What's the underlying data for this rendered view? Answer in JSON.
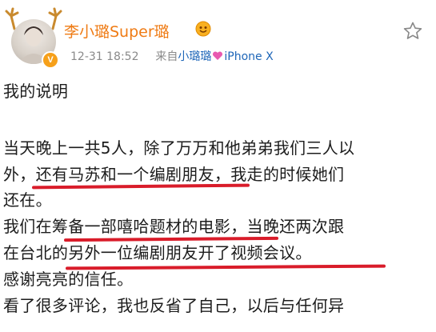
{
  "post": {
    "username": "李小璐Super璐",
    "timestamp": "12-31 18:52",
    "source_prefix": "来自",
    "source_name": "小璐璐",
    "source_device": "iPhone X",
    "lines": [
      "我的说明",
      "当天晚上一共5人，除了万万和他弟弟我们三人以",
      "外，",
      "还有马苏和一个编剧朋友",
      "，我走的时候她们",
      "还在。",
      "我们在",
      "筹备一部嘻哈题材的电影",
      "，当晚还两次跟",
      "在台北的",
      "另外一位编剧朋友开了视频会议。",
      "感谢亮亮的信任。",
      "看了很多评论，我也反省了自己，以后与任何异"
    ]
  },
  "icons": {
    "verified": "vip-badge-icon",
    "favorite": "star-outline-icon",
    "gold": "gold-member-icon",
    "source_heart": "heart-icon"
  },
  "colors": {
    "username": "#ef7b14",
    "link": "#1e66b8",
    "underline": "#d91c2a"
  }
}
